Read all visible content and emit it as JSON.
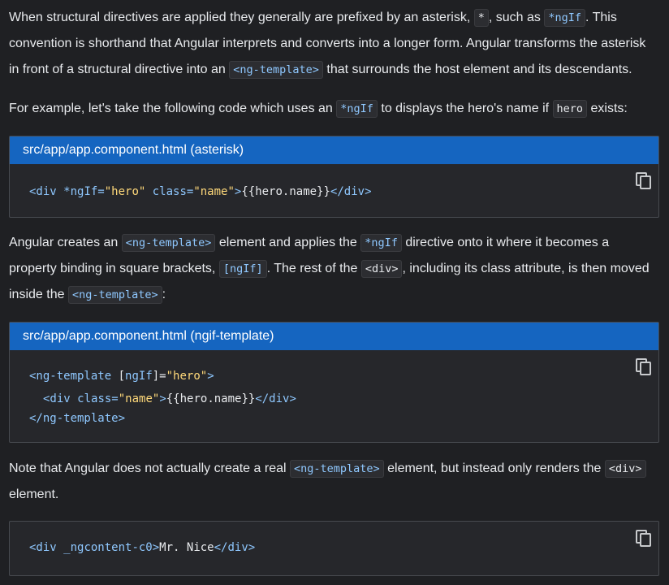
{
  "intro": {
    "p1_a": "When structural directives are applied they generally are prefixed by an asterisk,",
    "p1_code_asterisk": "*",
    "p1_b": ", such as",
    "p1_code_ngif": "*ngIf",
    "p1_c": ". This convention is shorthand that Angular interprets and converts into a longer form. Angular transforms the asterisk in front of a structural directive into an",
    "p1_code_ngtemplate": "<ng-template>",
    "p1_d": "that surrounds the host element and its descendants.",
    "p2_a": "For example, let's take the following code which uses an",
    "p2_code_ngif": "*ngIf",
    "p2_b": "to displays the hero's name if",
    "p2_code_hero": "hero",
    "p2_c": "exists:"
  },
  "block1": {
    "title": "src/app/app.component.html (asterisk)",
    "l1_open": "<div",
    "l1_attr1": "*ngIf=",
    "l1_val1": "\"hero\"",
    "l1_attr2": "class=",
    "l1_val2": "\"name\"",
    "l1_gt": ">",
    "l1_text": "{{hero.name}}",
    "l1_close": "</div>"
  },
  "mid": {
    "p3_a": "Angular creates an",
    "p3_code_ngtemplate": "<ng-template>",
    "p3_b": "element and applies the",
    "p3_code_ngif": "*ngIf",
    "p3_c": "directive onto it where it becomes a property binding in square brackets,",
    "p3_code_bracket": "[ngIf]",
    "p3_d": ". The rest of the",
    "p3_code_div": "<div>",
    "p3_e": ", including its class attribute, is then moved inside the",
    "p3_code_ngtemplate2": "<ng-template>",
    "p3_f": ":"
  },
  "block2": {
    "title": "src/app/app.component.html (ngif-template)",
    "l1_open": "<ng-template",
    "l1_b1": "[",
    "l1_attr": "ngIf",
    "l1_b2": "]=",
    "l1_val": "\"hero\"",
    "l1_gt": ">",
    "l2_open": "<div",
    "l2_attr": "class=",
    "l2_val": "\"name\"",
    "l2_gt": ">",
    "l2_text": "{{hero.name}}",
    "l2_close": "</div>",
    "l3": "</ng-template>"
  },
  "end": {
    "p4_a": "Note that Angular does not actually create a real",
    "p4_code_ngtemplate": "<ng-template>",
    "p4_b": "element, but instead only renders the",
    "p4_code_div": "<div>",
    "p4_c": "element."
  },
  "block3": {
    "l1_open": "<div",
    "l1_attr": "_ngcontent-c0",
    "l1_gt": ">",
    "l1_text": "Mr. Nice",
    "l1_close": "</div>"
  },
  "icons": {
    "copy": "copy-icon"
  }
}
